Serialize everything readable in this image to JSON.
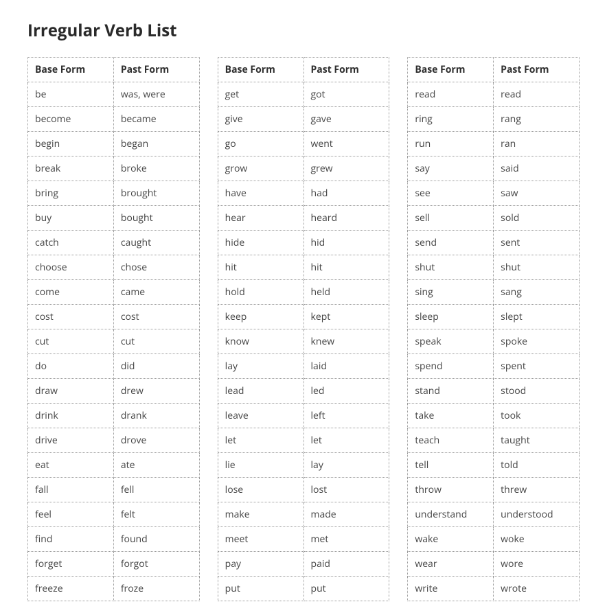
{
  "title": "Irregular Verb List",
  "headers": {
    "base": "Base Form",
    "past": "Past Form"
  },
  "tables": [
    {
      "rows": [
        {
          "base": "be",
          "past": "was, were"
        },
        {
          "base": "become",
          "past": "became"
        },
        {
          "base": "begin",
          "past": "began"
        },
        {
          "base": "break",
          "past": "broke"
        },
        {
          "base": "bring",
          "past": "brought"
        },
        {
          "base": "buy",
          "past": "bought"
        },
        {
          "base": "catch",
          "past": "caught"
        },
        {
          "base": "choose",
          "past": "chose"
        },
        {
          "base": "come",
          "past": "came"
        },
        {
          "base": "cost",
          "past": "cost"
        },
        {
          "base": "cut",
          "past": "cut"
        },
        {
          "base": "do",
          "past": "did"
        },
        {
          "base": "draw",
          "past": "drew"
        },
        {
          "base": "drink",
          "past": "drank"
        },
        {
          "base": "drive",
          "past": "drove"
        },
        {
          "base": "eat",
          "past": "ate"
        },
        {
          "base": "fall",
          "past": "fell"
        },
        {
          "base": "feel",
          "past": "felt"
        },
        {
          "base": "find",
          "past": "found"
        },
        {
          "base": "forget",
          "past": "forgot"
        },
        {
          "base": "freeze",
          "past": "froze"
        }
      ]
    },
    {
      "rows": [
        {
          "base": "get",
          "past": "got"
        },
        {
          "base": "give",
          "past": "gave"
        },
        {
          "base": "go",
          "past": "went"
        },
        {
          "base": "grow",
          "past": "grew"
        },
        {
          "base": "have",
          "past": "had"
        },
        {
          "base": "hear",
          "past": "heard"
        },
        {
          "base": "hide",
          "past": "hid"
        },
        {
          "base": "hit",
          "past": "hit"
        },
        {
          "base": "hold",
          "past": "held"
        },
        {
          "base": "keep",
          "past": "kept"
        },
        {
          "base": "know",
          "past": "knew"
        },
        {
          "base": "lay",
          "past": "laid"
        },
        {
          "base": "lead",
          "past": "led"
        },
        {
          "base": "leave",
          "past": "left"
        },
        {
          "base": "let",
          "past": "let"
        },
        {
          "base": "lie",
          "past": "lay"
        },
        {
          "base": "lose",
          "past": "lost"
        },
        {
          "base": "make",
          "past": "made"
        },
        {
          "base": "meet",
          "past": "met"
        },
        {
          "base": "pay",
          "past": "paid"
        },
        {
          "base": "put",
          "past": "put"
        }
      ]
    },
    {
      "rows": [
        {
          "base": "read",
          "past": "read"
        },
        {
          "base": "ring",
          "past": "rang"
        },
        {
          "base": "run",
          "past": "ran"
        },
        {
          "base": "say",
          "past": "said"
        },
        {
          "base": "see",
          "past": "saw"
        },
        {
          "base": "sell",
          "past": "sold"
        },
        {
          "base": "send",
          "past": "sent"
        },
        {
          "base": "shut",
          "past": "shut"
        },
        {
          "base": "sing",
          "past": "sang"
        },
        {
          "base": "sleep",
          "past": "slept"
        },
        {
          "base": "speak",
          "past": "spoke"
        },
        {
          "base": "spend",
          "past": "spent"
        },
        {
          "base": "stand",
          "past": "stood"
        },
        {
          "base": "take",
          "past": "took"
        },
        {
          "base": "teach",
          "past": "taught"
        },
        {
          "base": "tell",
          "past": "told"
        },
        {
          "base": "throw",
          "past": "threw"
        },
        {
          "base": "understand",
          "past": "understood"
        },
        {
          "base": "wake",
          "past": "woke"
        },
        {
          "base": "wear",
          "past": "wore"
        },
        {
          "base": "write",
          "past": "wrote"
        }
      ]
    }
  ]
}
